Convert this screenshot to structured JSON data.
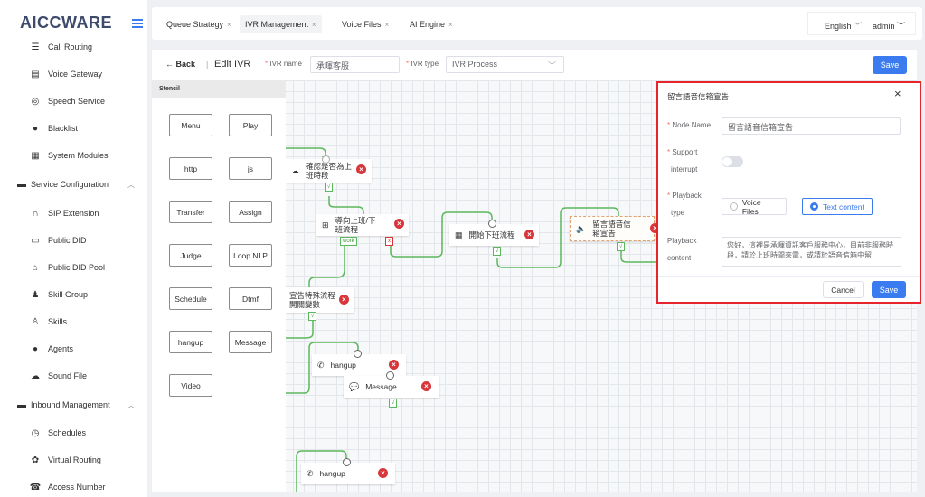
{
  "app": {
    "logo": "AICCWARE"
  },
  "sidebar": {
    "items": [
      {
        "label": "Call Routing",
        "icon": "list-icon",
        "type": "sub"
      },
      {
        "label": "Voice Gateway",
        "icon": "calendar-icon",
        "type": "sub"
      },
      {
        "label": "Speech Service",
        "icon": "target-icon",
        "type": "sub"
      },
      {
        "label": "Blacklist",
        "icon": "user-icon",
        "type": "sub"
      },
      {
        "label": "System Modules",
        "icon": "grid-icon",
        "type": "sub"
      },
      {
        "label": "Service Configuration",
        "icon": "card-icon",
        "type": "group"
      },
      {
        "label": "SIP Extension",
        "icon": "headset-icon",
        "type": "sub"
      },
      {
        "label": "Public DID",
        "icon": "folder-icon",
        "type": "sub"
      },
      {
        "label": "Public DID Pool",
        "icon": "home-icon",
        "type": "sub"
      },
      {
        "label": "Skill Group",
        "icon": "user-group-icon",
        "type": "sub"
      },
      {
        "label": "Skills",
        "icon": "person-icon",
        "type": "sub"
      },
      {
        "label": "Agents",
        "icon": "user-icon",
        "type": "sub"
      },
      {
        "label": "Sound File",
        "icon": "cloud-icon",
        "type": "sub"
      },
      {
        "label": "Inbound Management",
        "icon": "card-icon",
        "type": "group"
      },
      {
        "label": "Schedules",
        "icon": "clock-icon",
        "type": "sub"
      },
      {
        "label": "Virtual Routing",
        "icon": "gear-icon",
        "type": "sub"
      },
      {
        "label": "Access Number",
        "icon": "phone-icon",
        "type": "sub"
      }
    ]
  },
  "tabs": [
    {
      "label": "Queue Strategy",
      "active": false
    },
    {
      "label": "IVR Management",
      "active": true
    },
    {
      "label": "Voice Files",
      "active": false
    },
    {
      "label": "AI Engine",
      "active": false
    }
  ],
  "header": {
    "language": "English",
    "user": "admin"
  },
  "toolbar": {
    "back": "Back",
    "title": "Edit IVR",
    "ivr_name_label": "IVR name",
    "ivr_name_value": "承暉客服",
    "ivr_type_label": "IVR type",
    "ivr_type_value": "IVR Process",
    "save": "Save"
  },
  "stencil": {
    "title": "Stencil",
    "items": [
      "Menu",
      "Play",
      "http",
      "js",
      "Transfer",
      "Assign",
      "Judge",
      "Loop NLP",
      "Schedule",
      "Dtmf",
      "hangup",
      "Message",
      "Video"
    ]
  },
  "nodes": [
    {
      "label": "確認是否為上班時段",
      "icon": "cloud-icon"
    },
    {
      "label": "導向上班/下班流程",
      "icon": "table-icon"
    },
    {
      "label": "開始下班流程",
      "icon": "grid-icon"
    },
    {
      "label": "留言語音信箱宣告",
      "icon": "speaker-icon"
    },
    {
      "label": "宣告特殊流程開關變數",
      "icon": ""
    },
    {
      "label": "hangup",
      "icon": "phone-hangup-icon"
    },
    {
      "label": "Message",
      "icon": "chat-icon"
    },
    {
      "label": "hangup",
      "icon": "phone-hangup-icon"
    }
  ],
  "tags": {
    "work": "work",
    "x": "x",
    "check": "√"
  },
  "panel": {
    "title": "留言語音信箱宣告",
    "node_name_label": "Node Name",
    "node_name_value": "留言語音信箱宣告",
    "support_label": "Support",
    "interrupt_label": "interrupt",
    "playback_label": "Playback",
    "type_label": "type",
    "voice_files": "Voice Files",
    "text_content": "Text content",
    "content_label": "Playback",
    "content_label2": "content",
    "content_value": "您好，這裡是承暉資訊客戶服務中心，目前非服務時段，請於上班時間來電，或請於語音信箱中留",
    "cancel": "Cancel",
    "save": "Save",
    "close": "×"
  },
  "colors": {
    "accent": "#3a7bf0",
    "edge": "#5cb85c",
    "danger": "#d7363b",
    "highlight": "#e5242b"
  }
}
